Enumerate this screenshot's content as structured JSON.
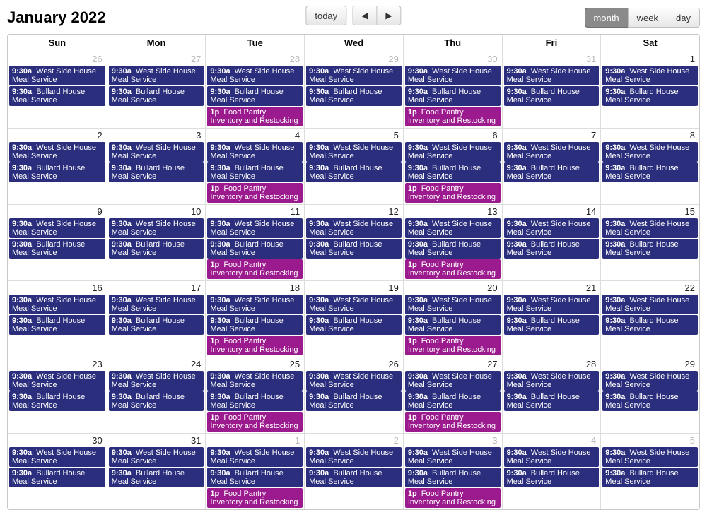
{
  "title": "January 2022",
  "buttons": {
    "today": "today",
    "month": "month",
    "week": "week",
    "day": "day"
  },
  "activeView": "month",
  "dayNames": [
    "Sun",
    "Mon",
    "Tue",
    "Wed",
    "Thu",
    "Fri",
    "Sat"
  ],
  "eventTypes": {
    "west": {
      "time": "9:30a",
      "title": "West Side House Meal Service",
      "color": "blue"
    },
    "bullard": {
      "time": "9:30a",
      "title": "Bullard House Meal Service",
      "color": "blue"
    },
    "pantry": {
      "time": "1p",
      "title": "Food Pantry Inventory and Restocking",
      "color": "purple"
    }
  },
  "weeks": [
    [
      {
        "n": 26,
        "other": true,
        "e": [
          "west",
          "bullard"
        ]
      },
      {
        "n": 27,
        "other": true,
        "e": [
          "west",
          "bullard"
        ]
      },
      {
        "n": 28,
        "other": true,
        "e": [
          "west",
          "bullard",
          "pantry"
        ]
      },
      {
        "n": 29,
        "other": true,
        "e": [
          "west",
          "bullard"
        ]
      },
      {
        "n": 30,
        "other": true,
        "e": [
          "west",
          "bullard",
          "pantry"
        ]
      },
      {
        "n": 31,
        "other": true,
        "e": [
          "west",
          "bullard"
        ]
      },
      {
        "n": 1,
        "other": false,
        "e": [
          "west",
          "bullard"
        ]
      }
    ],
    [
      {
        "n": 2,
        "other": false,
        "e": [
          "west",
          "bullard"
        ]
      },
      {
        "n": 3,
        "other": false,
        "e": [
          "west",
          "bullard"
        ]
      },
      {
        "n": 4,
        "other": false,
        "e": [
          "west",
          "bullard",
          "pantry"
        ]
      },
      {
        "n": 5,
        "other": false,
        "e": [
          "west",
          "bullard"
        ]
      },
      {
        "n": 6,
        "other": false,
        "e": [
          "west",
          "bullard",
          "pantry"
        ]
      },
      {
        "n": 7,
        "other": false,
        "e": [
          "west",
          "bullard"
        ]
      },
      {
        "n": 8,
        "other": false,
        "e": [
          "west",
          "bullard"
        ]
      }
    ],
    [
      {
        "n": 9,
        "other": false,
        "e": [
          "west",
          "bullard"
        ]
      },
      {
        "n": 10,
        "other": false,
        "e": [
          "west",
          "bullard"
        ]
      },
      {
        "n": 11,
        "other": false,
        "e": [
          "west",
          "bullard",
          "pantry"
        ]
      },
      {
        "n": 12,
        "other": false,
        "e": [
          "west",
          "bullard"
        ]
      },
      {
        "n": 13,
        "other": false,
        "e": [
          "west",
          "bullard",
          "pantry"
        ]
      },
      {
        "n": 14,
        "other": false,
        "e": [
          "west",
          "bullard"
        ]
      },
      {
        "n": 15,
        "other": false,
        "e": [
          "west",
          "bullard"
        ]
      }
    ],
    [
      {
        "n": 16,
        "other": false,
        "e": [
          "west",
          "bullard"
        ]
      },
      {
        "n": 17,
        "other": false,
        "e": [
          "west",
          "bullard"
        ]
      },
      {
        "n": 18,
        "other": false,
        "e": [
          "west",
          "bullard",
          "pantry"
        ]
      },
      {
        "n": 19,
        "other": false,
        "e": [
          "west",
          "bullard"
        ]
      },
      {
        "n": 20,
        "other": false,
        "e": [
          "west",
          "bullard",
          "pantry"
        ]
      },
      {
        "n": 21,
        "other": false,
        "e": [
          "west",
          "bullard"
        ]
      },
      {
        "n": 22,
        "other": false,
        "e": [
          "west",
          "bullard"
        ]
      }
    ],
    [
      {
        "n": 23,
        "other": false,
        "e": [
          "west",
          "bullard"
        ]
      },
      {
        "n": 24,
        "other": false,
        "e": [
          "west",
          "bullard"
        ]
      },
      {
        "n": 25,
        "other": false,
        "e": [
          "west",
          "bullard",
          "pantry"
        ]
      },
      {
        "n": 26,
        "other": false,
        "e": [
          "west",
          "bullard"
        ]
      },
      {
        "n": 27,
        "other": false,
        "e": [
          "west",
          "bullard",
          "pantry"
        ]
      },
      {
        "n": 28,
        "other": false,
        "e": [
          "west",
          "bullard"
        ]
      },
      {
        "n": 29,
        "other": false,
        "e": [
          "west",
          "bullard"
        ]
      }
    ],
    [
      {
        "n": 30,
        "other": false,
        "e": [
          "west",
          "bullard"
        ]
      },
      {
        "n": 31,
        "other": false,
        "e": [
          "west",
          "bullard"
        ]
      },
      {
        "n": 1,
        "other": true,
        "e": [
          "west",
          "bullard",
          "pantry"
        ]
      },
      {
        "n": 2,
        "other": true,
        "e": [
          "west",
          "bullard"
        ]
      },
      {
        "n": 3,
        "other": true,
        "e": [
          "west",
          "bullard",
          "pantry"
        ]
      },
      {
        "n": 4,
        "other": true,
        "e": [
          "west",
          "bullard"
        ]
      },
      {
        "n": 5,
        "other": true,
        "e": [
          "west",
          "bullard"
        ]
      }
    ]
  ]
}
